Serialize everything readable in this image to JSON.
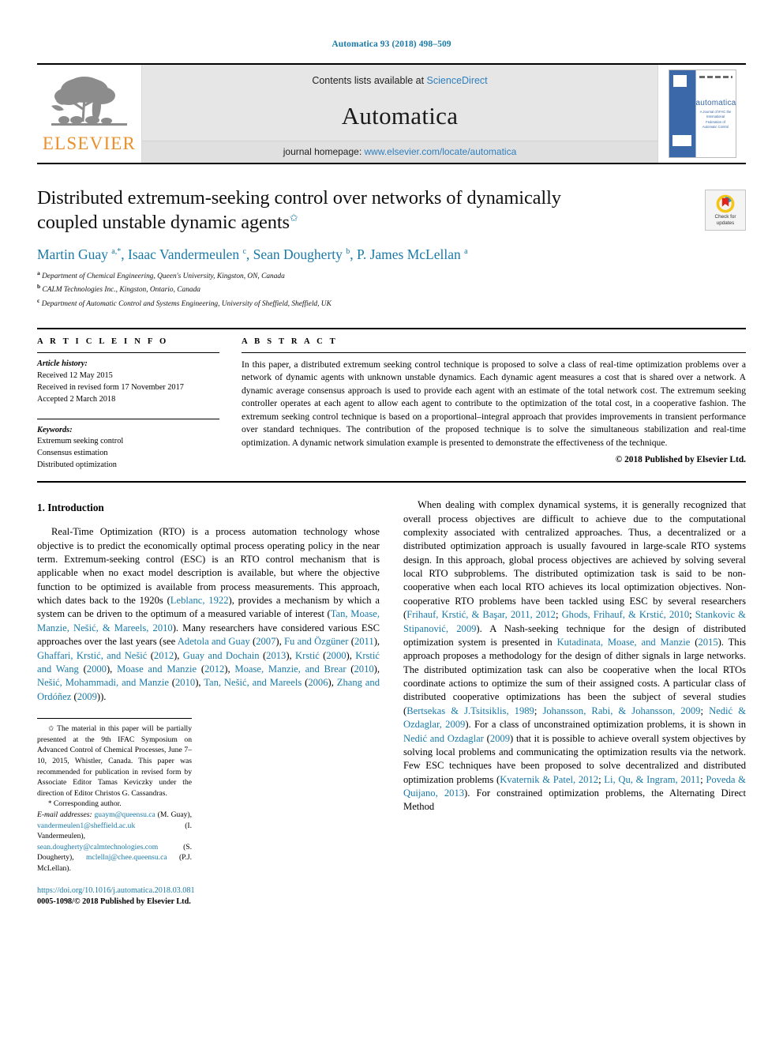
{
  "running_head": "Automatica 93 (2018) 498–509",
  "masthead": {
    "publisher_name": "ELSEVIER",
    "contents_prefix": "Contents lists available at ",
    "contents_link": "ScienceDirect",
    "journal_name": "Automatica",
    "homepage_prefix": "journal homepage: ",
    "homepage_link": "www.elsevier.com/locate/automatica",
    "cover_title": "automatica",
    "cover_subtitle": "A Journal of IFAC the International Federation of Automatic Control"
  },
  "article": {
    "title": "Distributed extremum-seeking control over networks of dynamically coupled unstable dynamic agents",
    "title_marker": "✩",
    "crossmark_label_line1": "Check for",
    "crossmark_label_line2": "updates",
    "authors_html": "Martin Guay <sup>a,</sup><sup>*</sup>, Isaac Vandermeulen <sup>c</sup>, Sean Dougherty <sup>b</sup>, P. James McLellan <sup>a</sup>",
    "affiliations": [
      {
        "marker": "a",
        "text": "Department of Chemical Engineering, Queen's University, Kingston, ON, Canada"
      },
      {
        "marker": "b",
        "text": "CALM Technologies Inc., Kingston, Ontario, Canada"
      },
      {
        "marker": "c",
        "text": "Department of Automatic Control and Systems Engineering, University of Sheffield, Sheffield, UK"
      }
    ]
  },
  "article_info": {
    "heading": "A R T I C L E   I N F O",
    "history_label": "Article history:",
    "history": [
      "Received 12 May 2015",
      "Received in revised form 17 November 2017",
      "Accepted 2 March 2018"
    ],
    "keywords_label": "Keywords:",
    "keywords": [
      "Extremum seeking control",
      "Consensus estimation",
      "Distributed optimization"
    ]
  },
  "abstract": {
    "heading": "A B S T R A C T",
    "text": "In this paper, a distributed extremum seeking control technique is proposed to solve a class of real-time optimization problems over a network of dynamic agents with unknown unstable dynamics. Each dynamic agent measures a cost that is shared over a network. A dynamic average consensus approach is used to provide each agent with an estimate of the total network cost. The extremum seeking controller operates at each agent to allow each agent to contribute to the optimization of the total cost, in a cooperative fashion. The extremum seeking control technique is based on a proportional–integral approach that provides improvements in transient performance over standard techniques. The contribution of the proposed technique is to solve the simultaneous stabilization and real-time optimization. A dynamic network simulation example is presented to demonstrate the effectiveness of the technique.",
    "copyright": "© 2018 Published by Elsevier Ltd."
  },
  "body": {
    "section_number_title": "1.  Introduction",
    "left_para_1_html": "Real-Time Optimization (RTO) is a process automation technology whose objective is to predict the economically optimal process operating policy in the near term. Extremum-seeking control (ESC) is an RTO control mechanism that is applicable when no exact model description is available, but where the objective function to be optimized is   available from process measurements. This approach, which dates back to the 1920s (<a class=\"cite\" href=\"#\">Leblanc, 1922</a>), provides a mechanism by which a system can be driven to the optimum of a measured variable of interest (<a class=\"cite\" href=\"#\">Tan, Moase, Manzie, Nešić, &amp; Mareels, 2010</a>). Many researchers have considered various ESC approaches over the last years (see <a class=\"cite\" href=\"#\">Adetola and Guay</a> (<a class=\"cite\" href=\"#\">2007</a>), <a class=\"cite\" href=\"#\">Fu and Özgüner</a> (<a class=\"cite\" href=\"#\">2011</a>), <a class=\"cite\" href=\"#\">Ghaffari, Krstić, and Nešić</a> (<a class=\"cite\" href=\"#\">2012</a>), <a class=\"cite\" href=\"#\">Guay and Dochain</a> (<a class=\"cite\" href=\"#\">2013</a>), <a class=\"cite\" href=\"#\">Krstić</a> (<a class=\"cite\" href=\"#\">2000</a>), <a class=\"cite\" href=\"#\">Krstić and Wang</a> (<a class=\"cite\" href=\"#\">2000</a>), <a class=\"cite\" href=\"#\">Moase and Manzie</a> (<a class=\"cite\" href=\"#\">2012</a>), <a class=\"cite\" href=\"#\">Moase, Manzie, and Brear</a> (<a class=\"cite\" href=\"#\">2010</a>), <a class=\"cite\" href=\"#\">Nešić, Mohammadi, and Manzie</a> (<a class=\"cite\" href=\"#\">2010</a>), <a class=\"cite\" href=\"#\">Tan, Nešić, and Mareels</a> (<a class=\"cite\" href=\"#\">2006</a>), <a class=\"cite\" href=\"#\">Zhang and Ordóñez</a> (<a class=\"cite\" href=\"#\">2009</a>)).",
    "right_para_1_html": "When dealing with complex dynamical systems, it is generally recognized that overall process objectives are difficult to achieve due to the computational complexity associated with centralized approaches. Thus, a decentralized or a distributed optimization approach is usually favoured in large-scale RTO systems design. In this approach, global process objectives are achieved by solving several local RTO subproblems. The distributed optimization task is said to be non-cooperative when each local RTO achieves its local optimization objectives. Non-cooperative RTO problems have been tackled using ESC by several researchers (<a class=\"cite\" href=\"#\">Frihauf, Krstić, &amp; Başar, 2011, 2012</a>; <a class=\"cite\" href=\"#\">Ghods, Frihauf, &amp; Krstić, 2010</a>; <a class=\"cite\" href=\"#\">Stankovic &amp; Stipanović, 2009</a>). A Nash-seeking technique for the design of distributed optimization system is presented in <a class=\"cite\" href=\"#\">Kutadinata, Moase, and Manzie</a> (<a class=\"cite\" href=\"#\">2015</a>). This approach proposes a methodology for the design of dither signals in large networks. The distributed optimization task can also be cooperative when the local RTOs coordinate actions to optimize the sum of their assigned costs. A particular class of distributed cooperative optimizations has been the subject of several studies (<a class=\"cite\" href=\"#\">Bertsekas &amp; J.Tsitsiklis, 1989</a>; <a class=\"cite\" href=\"#\">Johansson, Rabi, &amp; Johansson, 2009</a>; <a class=\"cite\" href=\"#\">Nedić &amp; Ozdaglar, 2009</a>). For a class of unconstrained optimization problems, it is shown in <a class=\"cite\" href=\"#\">Nedić and Ozdaglar</a> (<a class=\"cite\" href=\"#\">2009</a>) that it is possible to achieve overall system objectives by solving local problems and communicating the optimization results via the network. Few ESC techniques have been proposed to solve decentralized and distributed optimization problems (<a class=\"cite\" href=\"#\">Kvaternik &amp; Patel, 2012</a>; <a class=\"cite\" href=\"#\">Li, Qu, &amp; Ingram, 2011</a>; <a class=\"cite\" href=\"#\">Poveda &amp; Quijano, 2013</a>). For constrained optimization problems, the Alternating Direct Method"
  },
  "footnotes": {
    "star_symbol": "✩",
    "star_text": "The material in this paper will be partially presented at the 9th IFAC Symposium on Advanced Control of Chemical Processes, June 7–10, 2015, Whistler, Canada. This paper was recommended for publication in revised form by Associate Editor Tamas Keviczky under the direction of Editor Christos G. Cassandras.",
    "corresponding_symbol": "*",
    "corresponding_text": "Corresponding author.",
    "email_label": "E-mail addresses:",
    "emails_html": "<a href=\"#\">guaym@queensu.ca</a> (M. Guay), <a href=\"#\">vandermeulen1@sheffield.ac.uk</a> (I. Vandermeulen), <a href=\"#\">sean.dougherty@calmtechnologies.com</a> (S. Dougherty), <a href=\"#\">mclellnj@chee.queensu.ca</a> (P.J. McLellan).",
    "doi": "https://doi.org/10.1016/j.automatica.2018.03.081",
    "issn_line": "0005-1098/© 2018 Published by Elsevier Ltd."
  },
  "colors": {
    "link_blue": "#1a7aa8",
    "elsevier_orange": "#E8912A",
    "mast_gray": "#e6e6e6"
  }
}
